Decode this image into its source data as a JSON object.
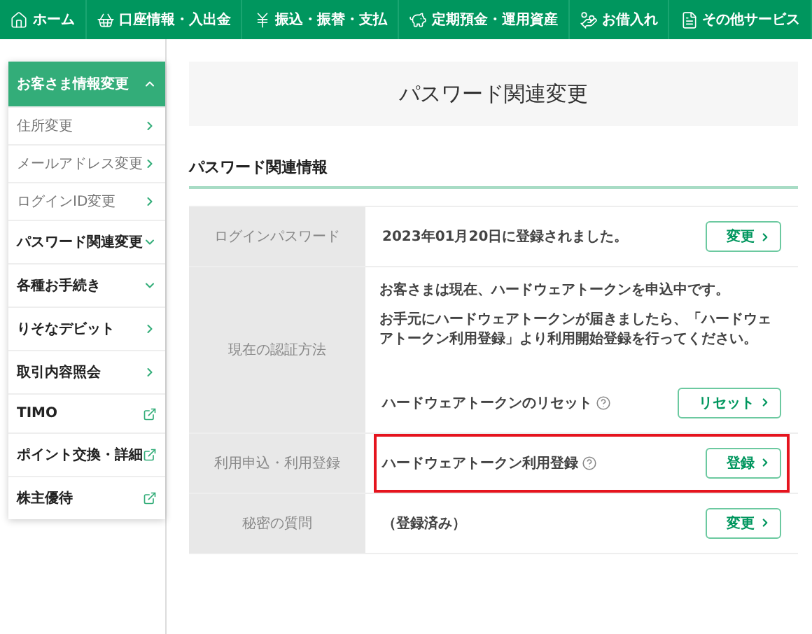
{
  "nav": [
    {
      "label": "ホーム",
      "kind": "home"
    },
    {
      "label": "口座情報・入出金",
      "kind": "basket"
    },
    {
      "label": "振込・振替・支払",
      "kind": "yen"
    },
    {
      "label": "定期預金・運用資産",
      "kind": "piggy"
    },
    {
      "label": "お借入れ",
      "kind": "loan"
    },
    {
      "label": "その他サービス",
      "kind": "document"
    }
  ],
  "sidebar": {
    "items": [
      {
        "label": "お客さま情報変更",
        "kind": "group",
        "expanded": true,
        "children": [
          {
            "label": "住所変更"
          },
          {
            "label": "メールアドレス変更"
          },
          {
            "label": "ログインID変更"
          }
        ]
      },
      {
        "label": "パスワード関連変更",
        "kind": "accordion",
        "expanded": false
      },
      {
        "label": "各種お手続き",
        "kind": "accordion",
        "expanded": false
      },
      {
        "label": "りそなデビット",
        "kind": "link"
      },
      {
        "label": "取引内容照会",
        "kind": "link"
      },
      {
        "label": "TIMO",
        "kind": "external"
      },
      {
        "label": "ポイント交換・詳細",
        "kind": "external"
      },
      {
        "label": "株主優待",
        "kind": "external"
      }
    ]
  },
  "page_title": "パスワード関連変更",
  "section_heading": "パスワード関連情報",
  "table": {
    "rows": [
      {
        "label": "ログインパスワード",
        "entries": [
          {
            "kind": "action",
            "text": "2023年01月20日に登録されました。",
            "help": false,
            "highlighted": false,
            "button": "変更"
          }
        ]
      },
      {
        "label": "現在の認証方法",
        "entries": [
          {
            "kind": "notice",
            "paragraphs": [
              "お客さまは現在、ハードウェアトークンを申込中です。",
              "お手元にハードウェアトークンが届きましたら、「ハードウェアトークン利用登録」より利用開始登録を行ってください。"
            ]
          },
          {
            "kind": "action",
            "text": "ハードウェアトークンのリセット",
            "help": true,
            "highlighted": false,
            "button": "リセット"
          }
        ]
      },
      {
        "label": "利用申込・利用登録",
        "entries": [
          {
            "kind": "action",
            "text": "ハードウェアトークン利用登録",
            "help": true,
            "highlighted": true,
            "button": "登録"
          }
        ]
      },
      {
        "label": "秘密の質問",
        "entries": [
          {
            "kind": "action",
            "text": "（登録済み）",
            "help": false,
            "highlighted": false,
            "button": "変更"
          }
        ]
      }
    ]
  }
}
